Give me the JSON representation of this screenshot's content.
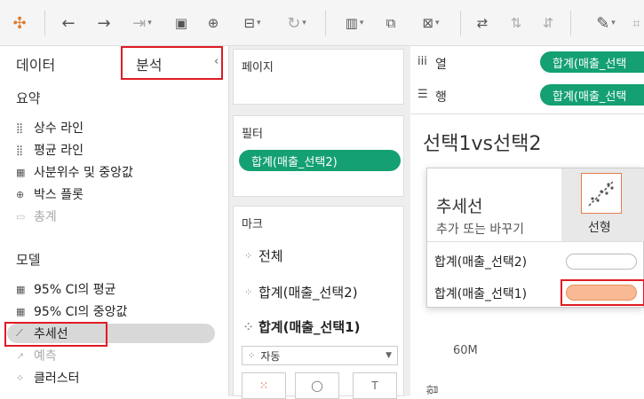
{
  "left_panel": {
    "tab_data": "데이터",
    "tab_analysis": "분석",
    "section_summary": "요약",
    "summary_items": [
      {
        "label": "상수 라인",
        "enabled": true
      },
      {
        "label": "평균 라인",
        "enabled": true
      },
      {
        "label": "사분위수 및 중앙값",
        "enabled": true
      },
      {
        "label": "박스 플롯",
        "enabled": true
      },
      {
        "label": "총계",
        "enabled": false
      }
    ],
    "section_model": "모델",
    "model_items": [
      {
        "label": "95% CI의 평균",
        "enabled": true
      },
      {
        "label": "95% CI의 중앙값",
        "enabled": true
      },
      {
        "label": "추세선",
        "enabled": true,
        "selected": true
      },
      {
        "label": "예측",
        "enabled": false
      },
      {
        "label": "클러스터",
        "enabled": true
      }
    ]
  },
  "cards": {
    "pages_title": "페이지",
    "filters_title": "필터",
    "filter_pill": "합계(매출_선택2)",
    "marks_title": "마크",
    "marks_rows": [
      "전체",
      "합계(매출_선택2)",
      "합계(매출_선택1)"
    ],
    "mark_type": "자동"
  },
  "shelves": {
    "columns_label": "열",
    "columns_pill": "합계(매출_선택",
    "rows_label": "행",
    "rows_pill": "합계(매출_선택"
  },
  "viz": {
    "title": "선택1vs선택2",
    "y_tick": "60M",
    "y_axis_partial": "합"
  },
  "popover": {
    "title": "추세선",
    "subtitle": "추가 또는 바꾸기",
    "linear_label": "선형",
    "rows": [
      {
        "label": "합계(매출_선택2)",
        "swatch": "#ffffff"
      },
      {
        "label": "합계(매출_선택1)",
        "swatch": "#f8b994"
      }
    ]
  },
  "colors": {
    "pill_green": "#14a073",
    "highlight_red": "#e01b24"
  }
}
